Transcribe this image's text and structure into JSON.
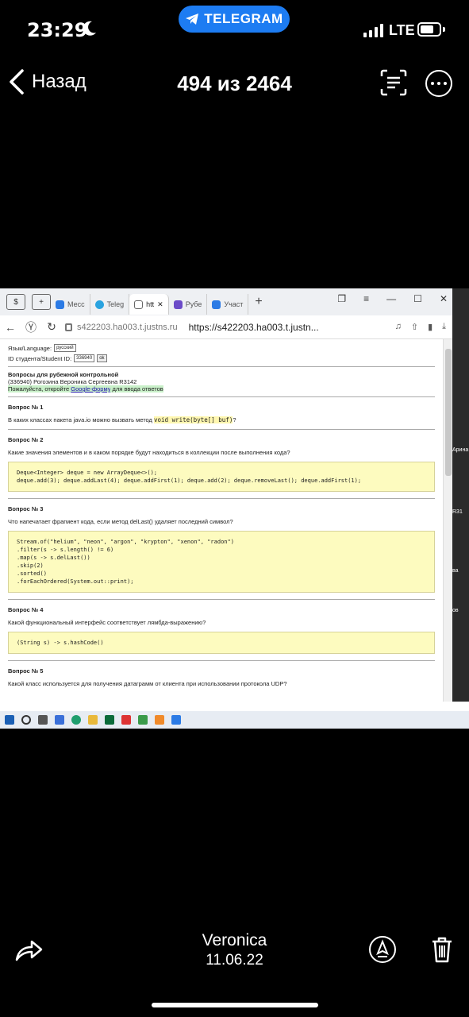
{
  "status_bar": {
    "time": "23:29",
    "pill_label": "TELEGRAM",
    "network": "LTE"
  },
  "header": {
    "back_label": "Назад",
    "counter": "494 из 2464"
  },
  "browser": {
    "tabs": [
      "Месс",
      "Teleg",
      "htt",
      "Рубе",
      "Участ"
    ],
    "address_host": "s422203.ha003.t.justns.ru",
    "address_url": "https://s422203.ha003.t.justn..."
  },
  "page": {
    "lang_label": "Язык/Language:",
    "lang_value": "русский",
    "student_id_label": "ID студента/Student ID:",
    "student_id_value": "336940",
    "ok_label": "ok",
    "title": "Вопросы для рубежной контрольной",
    "student_line": "(336940) Рогозина Вероника Сергеевна R3142",
    "hint_before": "Пожалуйста, откройте ",
    "hint_link": "Google-форму",
    "hint_after": " для ввода ответов",
    "questions": [
      {
        "title": "Вопрос № 1",
        "text": "В каких классах пакета java.io можно вызвать метод ",
        "inline_code": "void write(byte[] buf)",
        "text_after": "?"
      },
      {
        "title": "Вопрос № 2",
        "text": "Какие значения элементов и в каком порядке будут находиться в коллекции после выполнения кода?",
        "code": "Deque<Integer> deque = new ArrayDeque<>();\ndeque.add(3); deque.addLast(4); deque.addFirst(1); deque.add(2); deque.removeLast(); deque.addFirst(1);"
      },
      {
        "title": "Вопрос № 3",
        "text": "Что напечатает фрагмент кода, если метод delLast() удаляет последний символ?",
        "code": "Stream.of(\"helium\", \"neon\", \"argon\", \"krypton\", \"xenon\", \"radon\")\n.filter(s -> s.length() != 6)\n.map(s -> s.delLast())\n.skip(2)\n.sorted()\n.forEachOrdered(System.out::print);"
      },
      {
        "title": "Вопрос № 4",
        "text": "Какой функциональный интерфейс соответствует лямбда-выражению?",
        "code": "(String s) -> s.hashCode()"
      },
      {
        "title": "Вопрос № 5",
        "text": "Какой класс используется для получения датаграмм от клиента при использовании протокола UDP?"
      }
    ]
  },
  "side_panel": {
    "labels": [
      "Арина",
      "R31",
      "ва",
      "ов"
    ]
  },
  "footer": {
    "sender": "Veronica",
    "date": "11.06.22"
  },
  "colors": {
    "pill": "#1d7cf2",
    "code_bg": "#fdfbbf",
    "highlight": "#c9f0c9"
  }
}
